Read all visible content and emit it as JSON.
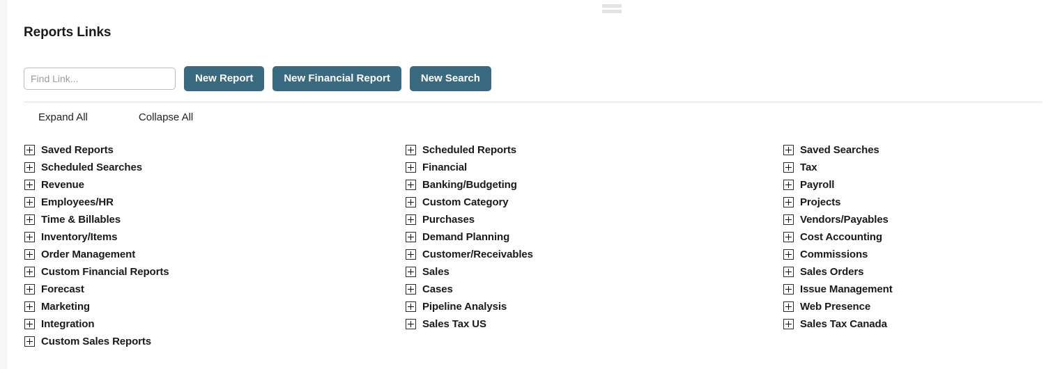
{
  "header": {
    "title": "Reports Links"
  },
  "toolbar": {
    "find_placeholder": "Find Link...",
    "find_value": "",
    "new_report_label": "New Report",
    "new_financial_report_label": "New Financial Report",
    "new_search_label": "New Search",
    "button_color": "#3a6a80"
  },
  "tree_controls": {
    "expand_all_label": "Expand All",
    "collapse_all_label": "Collapse All"
  },
  "columns": [
    {
      "items": [
        {
          "label": "Saved Reports",
          "icon": "plus-box-icon"
        },
        {
          "label": "Scheduled Searches",
          "icon": "plus-box-icon"
        },
        {
          "label": "Revenue",
          "icon": "plus-box-icon"
        },
        {
          "label": "Employees/HR",
          "icon": "plus-box-icon"
        },
        {
          "label": "Time & Billables",
          "icon": "plus-box-icon"
        },
        {
          "label": "Inventory/Items",
          "icon": "plus-box-icon"
        },
        {
          "label": "Order Management",
          "icon": "plus-box-icon"
        },
        {
          "label": "Custom Financial Reports",
          "icon": "plus-box-icon"
        },
        {
          "label": "Forecast",
          "icon": "plus-box-icon"
        },
        {
          "label": "Marketing",
          "icon": "plus-box-icon"
        },
        {
          "label": "Integration",
          "icon": "plus-box-icon"
        },
        {
          "label": "Custom Sales Reports",
          "icon": "plus-box-icon"
        }
      ]
    },
    {
      "items": [
        {
          "label": "Scheduled Reports",
          "icon": "plus-box-icon"
        },
        {
          "label": "Financial",
          "icon": "plus-box-icon"
        },
        {
          "label": "Banking/Budgeting",
          "icon": "plus-box-icon"
        },
        {
          "label": "Custom Category",
          "icon": "plus-box-icon"
        },
        {
          "label": "Purchases",
          "icon": "plus-box-icon"
        },
        {
          "label": "Demand Planning",
          "icon": "plus-box-icon"
        },
        {
          "label": "Customer/Receivables",
          "icon": "plus-box-icon"
        },
        {
          "label": "Sales",
          "icon": "plus-box-icon"
        },
        {
          "label": "Cases",
          "icon": "plus-box-icon"
        },
        {
          "label": "Pipeline Analysis",
          "icon": "plus-box-icon"
        },
        {
          "label": "Sales Tax US",
          "icon": "plus-box-icon"
        }
      ]
    },
    {
      "items": [
        {
          "label": "Saved Searches",
          "icon": "plus-box-icon"
        },
        {
          "label": "Tax",
          "icon": "plus-box-icon"
        },
        {
          "label": "Payroll",
          "icon": "plus-box-icon"
        },
        {
          "label": "Projects",
          "icon": "plus-box-icon"
        },
        {
          "label": "Vendors/Payables",
          "icon": "plus-box-icon"
        },
        {
          "label": "Cost Accounting",
          "icon": "plus-box-icon"
        },
        {
          "label": "Commissions",
          "icon": "plus-box-icon"
        },
        {
          "label": "Sales Orders",
          "icon": "plus-box-icon"
        },
        {
          "label": "Issue Management",
          "icon": "plus-box-icon"
        },
        {
          "label": "Web Presence",
          "icon": "plus-box-icon"
        },
        {
          "label": "Sales Tax Canada",
          "icon": "plus-box-icon"
        }
      ]
    }
  ]
}
